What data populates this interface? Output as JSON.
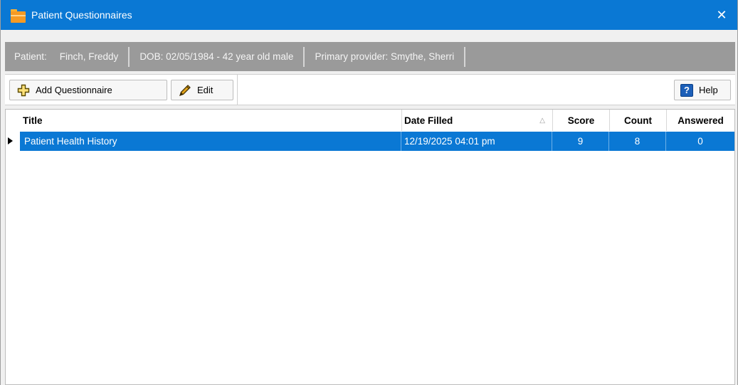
{
  "window": {
    "title": "Patient Questionnaires",
    "close_glyph": "✕",
    "icon": "folder-icon"
  },
  "info": {
    "patient_label": "Patient:",
    "patient_name": "Finch, Freddy",
    "dob": "DOB: 02/05/1984 - 42 year old male",
    "provider": "Primary provider: Smythe, Sherri"
  },
  "toolbar": {
    "add_label": "Add Questionnaire",
    "add_icon": "plus-outline-icon",
    "edit_label": "Edit",
    "edit_icon": "pencil-icon",
    "help_label": "Help",
    "help_icon": "question-mark-icon",
    "help_glyph": "?"
  },
  "table": {
    "columns": {
      "title": "Title",
      "date": "Date Filled",
      "score": "Score",
      "count": "Count",
      "answered": "Answered"
    },
    "sort_glyph": "△",
    "rows": [
      {
        "title": "Patient Health History",
        "date": "12/19/2025 04:01 pm",
        "score": "9",
        "count": "8",
        "answered": "0",
        "selected": true
      }
    ]
  },
  "colors": {
    "titlebar": "#0a78d4",
    "selection": "#0a78d4",
    "infobar": "#9a9a9a"
  }
}
